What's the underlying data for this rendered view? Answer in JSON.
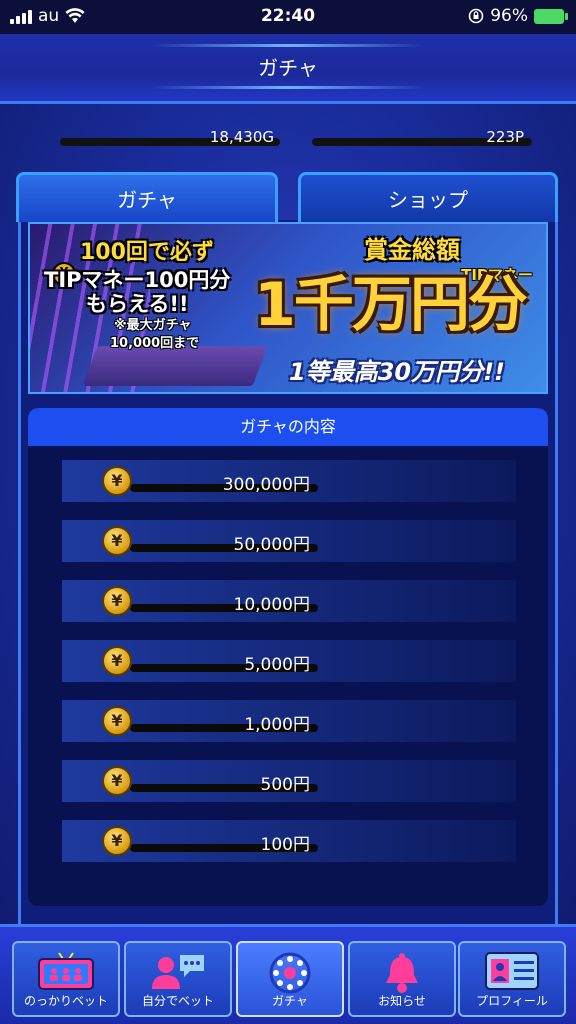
{
  "status_bar": {
    "carrier": "au",
    "time": "22:40",
    "battery": "96%"
  },
  "header": {
    "title": "ガチャ"
  },
  "currency": {
    "gold": "18,430G",
    "points": "223P"
  },
  "tabs": [
    {
      "label": "ガチャ",
      "active": true
    },
    {
      "label": "ショップ",
      "active": false
    }
  ],
  "banner": {
    "promo_line1": "100回で必ず",
    "promo_line2": "TIPマネー100円分",
    "promo_line3": "もらえる!!",
    "promo_note1": "※最大ガチャ",
    "promo_note2": "10,000回まで",
    "total_label": "賞金総額",
    "tip_money": "TIPマネー",
    "amount": "1千万円分",
    "max_prize": "1等最高30万円分!!"
  },
  "contents": {
    "title": "ガチャの内容",
    "prizes": [
      "300,000円",
      "50,000円",
      "10,000円",
      "5,000円",
      "1,000円",
      "500円",
      "100円"
    ]
  },
  "bottom_nav": [
    {
      "label": "のっかりベット",
      "active": false
    },
    {
      "label": "自分でベット",
      "active": false
    },
    {
      "label": "ガチャ",
      "active": true
    },
    {
      "label": "お知らせ",
      "active": false
    },
    {
      "label": "プロフィール",
      "active": false
    }
  ]
}
